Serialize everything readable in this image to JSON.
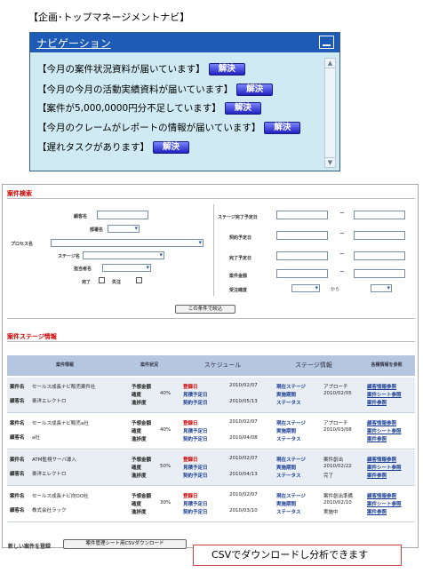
{
  "page_title": "【企画･トップマネージメントナビ】",
  "nav": {
    "title": "ナビゲーション",
    "resolve_label": "解決",
    "items": [
      "【今月の案件状況資料が届いています】",
      "【今月の今月の活動実績資料が届いています】",
      "【案件が5,000,0000円分不足しています】",
      "【今月のクレームがレポートの情報が届いています】",
      "【遅れタスクがあります】"
    ]
  },
  "search": {
    "title": "案件検索",
    "labels": {
      "customer": "顧客名",
      "department": "部署名",
      "process": "プロセス名",
      "stage": "ステージ名",
      "owner": "担当者名",
      "complete": "完了",
      "lost": "失注",
      "stage_done_date": "ステージ完了予定日",
      "contract_date": "契約予定日",
      "completion_date": "完了予定日",
      "amount": "案件金額",
      "confidence": "受注確度",
      "from": "から"
    },
    "range_sep": "~",
    "search_button": "この条件で絞込"
  },
  "stage_info": {
    "title": "案件ステージ情報",
    "headers": [
      "案件情報",
      "案件状況",
      "スケジュール",
      "ステージ情報",
      "各種情報を参照"
    ],
    "row_labels": {
      "case": "案件名",
      "customer": "顧客名",
      "amount": "予想金額",
      "confidence": "確度",
      "progress": "進捗度",
      "registered": "登録日",
      "estimate_date": "見積予定日",
      "contract_date": "契約予定日",
      "current_stage": "現在ステージ",
      "done_period": "実施期間",
      "status": "ステータス",
      "link1": "顧客情報参照",
      "link2": "案件シート参照",
      "link3": "案件参照"
    },
    "rows": [
      {
        "case": "セールス成長ナビ販売案件社",
        "customer": "楽洋エレクトロ",
        "confidence": "40%",
        "registered": "2010/02/07",
        "contract": "2010/05/13",
        "stage": "アプローチ",
        "period": "2010/02/05",
        "status": ""
      },
      {
        "case": "セールス成長ナビ販売a社",
        "customer": "a社",
        "confidence": "40%",
        "registered": "2010/02/07",
        "contract": "2010/04/08",
        "stage": "アプローチ",
        "period": "2010/03/08",
        "status": ""
      },
      {
        "case": "ATM監視サーバ導入",
        "customer": "楽洋エレクトロ",
        "confidence": "50%",
        "registered": "2010/02/07",
        "contract": "2010/04/13",
        "stage": "案件創出",
        "period": "2010/02/22",
        "status": "完了"
      },
      {
        "case": "セールス成長ナビ向OO社",
        "customer": "株式会社ラック",
        "confidence": "30%",
        "registered": "2010/02/07",
        "contract": "2010/03/10",
        "stage": "案件創出準備",
        "period": "2010/02/10",
        "status": "実施中"
      }
    ]
  },
  "footer": {
    "new_case": "新しい案件を登録",
    "csv_button": "案件管理シート用CSVダウンロード"
  },
  "callout": "CSVでダウンロードし分析できます"
}
